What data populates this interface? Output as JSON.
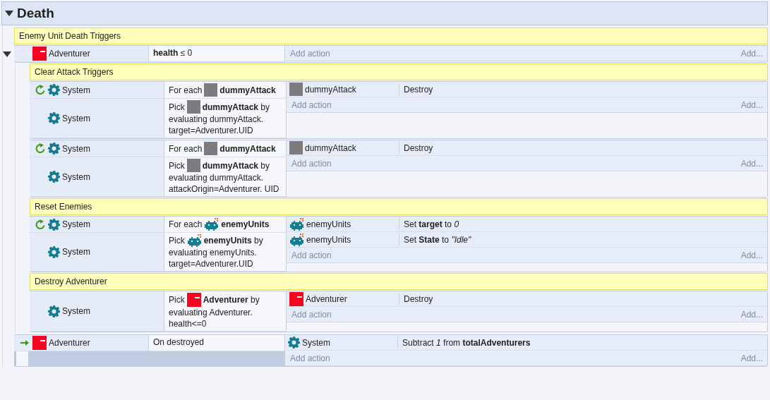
{
  "group": {
    "title": "Death",
    "expanded": true
  },
  "items": [
    {
      "kind": "comment",
      "text": "Enemy Unit Death Triggers"
    },
    {
      "kind": "event",
      "expanded": true,
      "trigger": false,
      "conditions": [
        {
          "kind": "sprite",
          "object": "Adventurer",
          "loop": false,
          "parts": [
            {
              "kind": "word",
              "text": "**health** ≤ 0"
            }
          ]
        }
      ],
      "add_action": "Add action",
      "add_more": "Add...",
      "children": [
        {
          "kind": "comment",
          "text": "Clear Attack Triggers"
        },
        {
          "kind": "event",
          "trigger": false,
          "conditions": [
            {
              "kind": "system",
              "object": "System",
              "loop": true,
              "parts": [
                {
                  "kind": "word",
                  "text": "For each"
                },
                {
                  "kind": "box"
                },
                {
                  "kind": "word",
                  "text": "**dummyAttack**"
                }
              ]
            },
            {
              "kind": "system",
              "object": "System",
              "loop": false,
              "parts": [
                {
                  "kind": "word",
                  "text": "Pick"
                },
                {
                  "kind": "box"
                },
                {
                  "kind": "word",
                  "text": "**dummyAttack** by"
                },
                {
                  "kind": "line",
                  "text": "evaluating dummyAttack. target=Adventurer.UID"
                }
              ]
            }
          ],
          "actions": [
            {
              "kind": "box",
              "object": "dummyAttack",
              "text": "Destroy"
            }
          ],
          "add_action": "Add action",
          "add_more": "Add..."
        },
        {
          "kind": "event",
          "trigger": false,
          "conditions": [
            {
              "kind": "system",
              "object": "System",
              "loop": true,
              "parts": [
                {
                  "kind": "word",
                  "text": "For each"
                },
                {
                  "kind": "box"
                },
                {
                  "kind": "word",
                  "text": "**dummyAttack**"
                }
              ]
            },
            {
              "kind": "system",
              "object": "System",
              "loop": false,
              "parts": [
                {
                  "kind": "word",
                  "text": "Pick"
                },
                {
                  "kind": "box"
                },
                {
                  "kind": "word",
                  "text": "**dummyAttack** by"
                },
                {
                  "kind": "line",
                  "text": "evaluating dummyAttack. attackOrigin=Adventurer. UID"
                }
              ]
            }
          ],
          "actions": [
            {
              "kind": "box",
              "object": "dummyAttack",
              "text": "Destroy"
            }
          ],
          "add_action": "Add action",
          "add_more": "Add..."
        },
        {
          "kind": "comment",
          "text": "Reset Enemies"
        },
        {
          "kind": "event",
          "trigger": false,
          "conditions": [
            {
              "kind": "system",
              "object": "System",
              "loop": true,
              "parts": [
                {
                  "kind": "word",
                  "text": "For each"
                },
                {
                  "kind": "invader"
                },
                {
                  "kind": "word",
                  "text": "**enemyUnits**"
                }
              ]
            },
            {
              "kind": "system",
              "object": "System",
              "loop": false,
              "parts": [
                {
                  "kind": "word",
                  "text": "Pick"
                },
                {
                  "kind": "invader"
                },
                {
                  "kind": "word",
                  "text": "**enemyUnits** by"
                },
                {
                  "kind": "line",
                  "text": "evaluating enemyUnits. target=Adventurer.UID"
                }
              ]
            }
          ],
          "actions": [
            {
              "kind": "invader",
              "object": "enemyUnits",
              "text": "Set **target** to *0*"
            },
            {
              "kind": "invader",
              "object": "enemyUnits",
              "text": "Set **State** to *\"Idle\"*"
            }
          ],
          "add_action": "Add action",
          "add_more": "Add..."
        },
        {
          "kind": "comment",
          "text": "Destroy Adventurer"
        },
        {
          "kind": "event",
          "trigger": false,
          "conditions": [
            {
              "kind": "system",
              "object": "System",
              "loop": false,
              "parts": [
                {
                  "kind": "word",
                  "text": "Pick"
                },
                {
                  "kind": "sprite"
                },
                {
                  "kind": "word",
                  "text": "**Adventurer** by"
                },
                {
                  "kind": "line",
                  "text": "evaluating Adventurer. health<=0"
                }
              ]
            }
          ],
          "actions": [
            {
              "kind": "sprite",
              "object": "Adventurer",
              "text": "Destroy"
            }
          ],
          "add_action": "Add action",
          "add_more": "Add..."
        }
      ]
    },
    {
      "kind": "event",
      "trigger": true,
      "conditions": [
        {
          "kind": "sprite",
          "object": "Adventurer",
          "loop": false,
          "parts": [
            {
              "kind": "word",
              "text": "On destroyed"
            }
          ]
        }
      ],
      "actions": [
        {
          "kind": "system",
          "object": "System",
          "text": "Subtract *1* from **totalAdventurers**"
        }
      ],
      "add_action": "Add action",
      "add_more": "Add..."
    }
  ]
}
